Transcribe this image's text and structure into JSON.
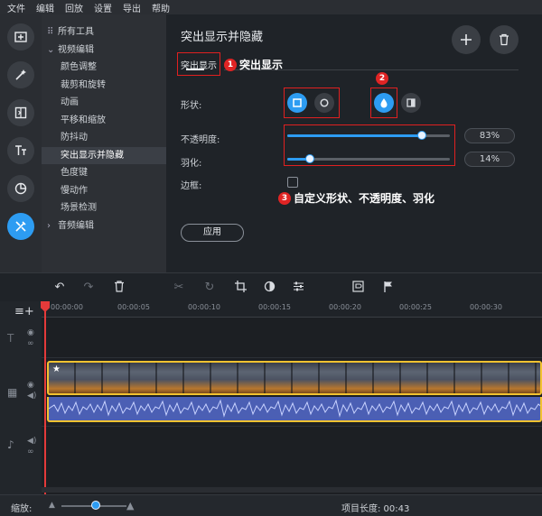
{
  "menu": [
    "文件",
    "编辑",
    "回放",
    "设置",
    "导出",
    "帮助"
  ],
  "tree": {
    "items": [
      {
        "label": "所有工具",
        "icon": "grid-icon"
      },
      {
        "label": "视频编辑",
        "caret": "⌄"
      },
      {
        "label": "颜色调整"
      },
      {
        "label": "裁剪和旋转"
      },
      {
        "label": "动画"
      },
      {
        "label": "平移和缩放"
      },
      {
        "label": "防抖动"
      },
      {
        "label": "突出显示并隐藏",
        "active": true
      },
      {
        "label": "色度键"
      },
      {
        "label": "慢动作"
      },
      {
        "label": "场景检测"
      },
      {
        "label": "音频编辑",
        "caret": "›"
      }
    ]
  },
  "panel": {
    "title": "突出显示并隐藏",
    "tab_label": "突出显示",
    "shape_label": "形状:",
    "opacity_label": "不透明度:",
    "feather_label": "羽化:",
    "border_label": "边框:",
    "apply_label": "应用",
    "opacity_value": "83%",
    "feather_value": "14%",
    "opacity_fraction": 0.83,
    "feather_fraction": 0.14,
    "border_checked": false
  },
  "annotations": {
    "a1": {
      "num": "1",
      "text": "突出显示"
    },
    "a2": {
      "num": "2"
    },
    "a3": {
      "num": "3",
      "text": "自定义形状、不透明度、羽化"
    }
  },
  "timeline": {
    "ticks": [
      "00:00:00",
      "00:00:05",
      "00:00:10",
      "00:00:15",
      "00:00:20",
      "00:00:25",
      "00:00:30"
    ]
  },
  "status": {
    "zoom_label": "缩放:",
    "duration_label": "项目长度: 00:43"
  },
  "colors": {
    "accent": "#2d9cf2",
    "highlight": "#e02020",
    "clip_border": "#f2c230"
  }
}
